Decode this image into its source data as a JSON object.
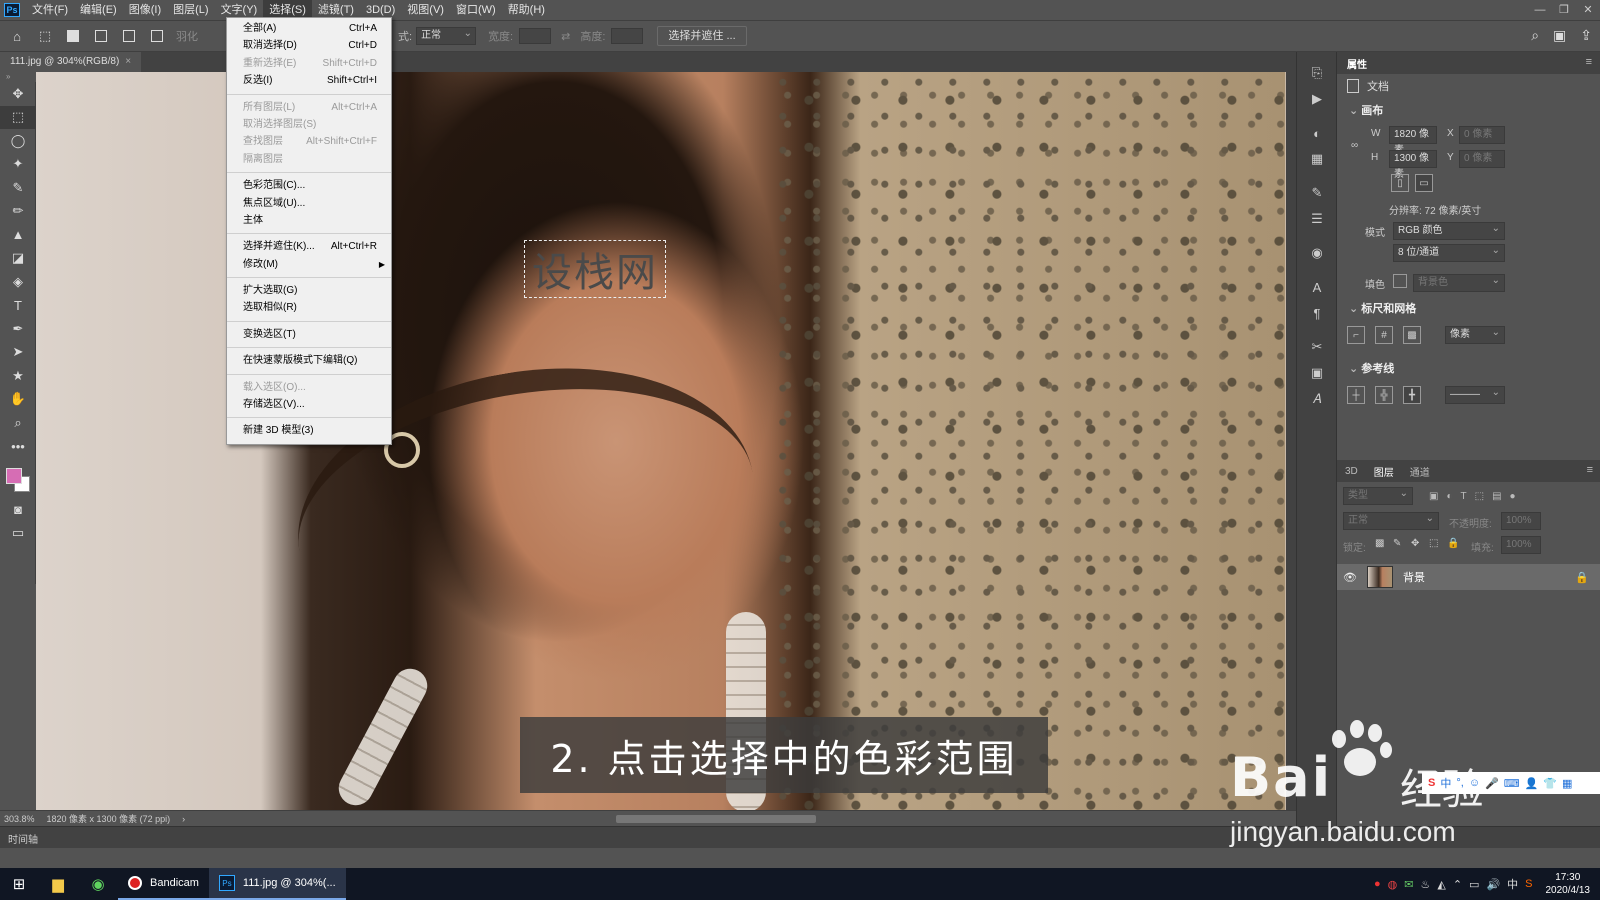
{
  "app": {
    "logo": "Ps"
  },
  "menubar": {
    "items": [
      "文件(F)",
      "编辑(E)",
      "图像(I)",
      "图层(L)",
      "文字(Y)",
      "选择(S)",
      "滤镜(T)",
      "3D(D)",
      "视图(V)",
      "窗口(W)",
      "帮助(H)"
    ],
    "active_index": 5
  },
  "options_bar": {
    "feather_label": "羽化",
    "style_label": "式:",
    "style_value": "正常",
    "width_label": "宽度:",
    "height_label": "高度:",
    "select_mask_button": "选择并遮住 ..."
  },
  "document": {
    "tab_title": "111.jpg @ 304%(RGB/8)",
    "close_glyph": "×",
    "watermark_text": "设栈网",
    "caption": "2. 点击选择中的色彩范围"
  },
  "select_menu": {
    "items": [
      {
        "label": "全部(A)",
        "shortcut": "Ctrl+A",
        "disabled": false
      },
      {
        "label": "取消选择(D)",
        "shortcut": "Ctrl+D",
        "disabled": false
      },
      {
        "label": "重新选择(E)",
        "shortcut": "Shift+Ctrl+D",
        "disabled": true
      },
      {
        "label": "反选(I)",
        "shortcut": "Shift+Ctrl+I",
        "disabled": false
      },
      {
        "separator": true
      },
      {
        "label": "所有图层(L)",
        "shortcut": "Alt+Ctrl+A",
        "disabled": true
      },
      {
        "label": "取消选择图层(S)",
        "shortcut": "",
        "disabled": true
      },
      {
        "label": "查找图层",
        "shortcut": "Alt+Shift+Ctrl+F",
        "disabled": true
      },
      {
        "label": "隔离图层",
        "shortcut": "",
        "disabled": true
      },
      {
        "separator": true
      },
      {
        "label": "色彩范围(C)...",
        "shortcut": "",
        "disabled": false
      },
      {
        "label": "焦点区域(U)...",
        "shortcut": "",
        "disabled": false
      },
      {
        "label": "主体",
        "shortcut": "",
        "disabled": false
      },
      {
        "separator": true
      },
      {
        "label": "选择并遮住(K)...",
        "shortcut": "Alt+Ctrl+R",
        "disabled": false
      },
      {
        "label": "修改(M)",
        "shortcut": "",
        "disabled": false,
        "submenu": true
      },
      {
        "separator": true
      },
      {
        "label": "扩大选取(G)",
        "shortcut": "",
        "disabled": false
      },
      {
        "label": "选取相似(R)",
        "shortcut": "",
        "disabled": false
      },
      {
        "separator": true
      },
      {
        "label": "变换选区(T)",
        "shortcut": "",
        "disabled": false
      },
      {
        "separator": true
      },
      {
        "label": "在快速蒙版模式下编辑(Q)",
        "shortcut": "",
        "disabled": false
      },
      {
        "separator": true
      },
      {
        "label": "载入选区(O)...",
        "shortcut": "",
        "disabled": true
      },
      {
        "label": "存储选区(V)...",
        "shortcut": "",
        "disabled": false
      },
      {
        "separator": true
      },
      {
        "label": "新建 3D 模型(3)",
        "shortcut": "",
        "disabled": false
      }
    ]
  },
  "status_bar": {
    "zoom": "303.8%",
    "doc_info": "1820 像素 x 1300 像素 (72 ppi)"
  },
  "timeline": {
    "label": "时间轴"
  },
  "properties_panel": {
    "tab": "属性",
    "doc_label": "文档",
    "canvas_section": "画布",
    "w_label": "W",
    "w_value": "1820 像素",
    "h_label": "H",
    "h_value": "1300 像素",
    "x_label": "X",
    "x_value": "0 像素",
    "y_label": "Y",
    "y_value": "0 像素",
    "resolution": "分辨率: 72 像素/英寸",
    "mode_label": "模式",
    "mode_value": "RGB 颜色",
    "depth_value": "8 位/通道",
    "fill_label": "填色",
    "fill_value": "背景色",
    "rulers_section": "标尺和网格",
    "ruler_unit": "像素",
    "guides_section": "参考线"
  },
  "layers_panel": {
    "tabs": [
      "3D",
      "图层",
      "通道"
    ],
    "active_tab": 1,
    "filter_placeholder": "类型",
    "blend_mode": "正常",
    "opacity_label": "不透明度:",
    "opacity_value": "100%",
    "lock_label": "锁定:",
    "fill_label": "填充:",
    "fill_value": "100%",
    "layer_name": "背景"
  },
  "watermark": {
    "brand": "Bai",
    "brand_suffix": "经验",
    "url": "jingyan.baidu.com"
  },
  "taskbar": {
    "apps": [
      "Bandicam",
      "111.jpg @ 304%(..."
    ],
    "tray_ime": "中",
    "time": "17:30",
    "date": "2020/4/13"
  }
}
